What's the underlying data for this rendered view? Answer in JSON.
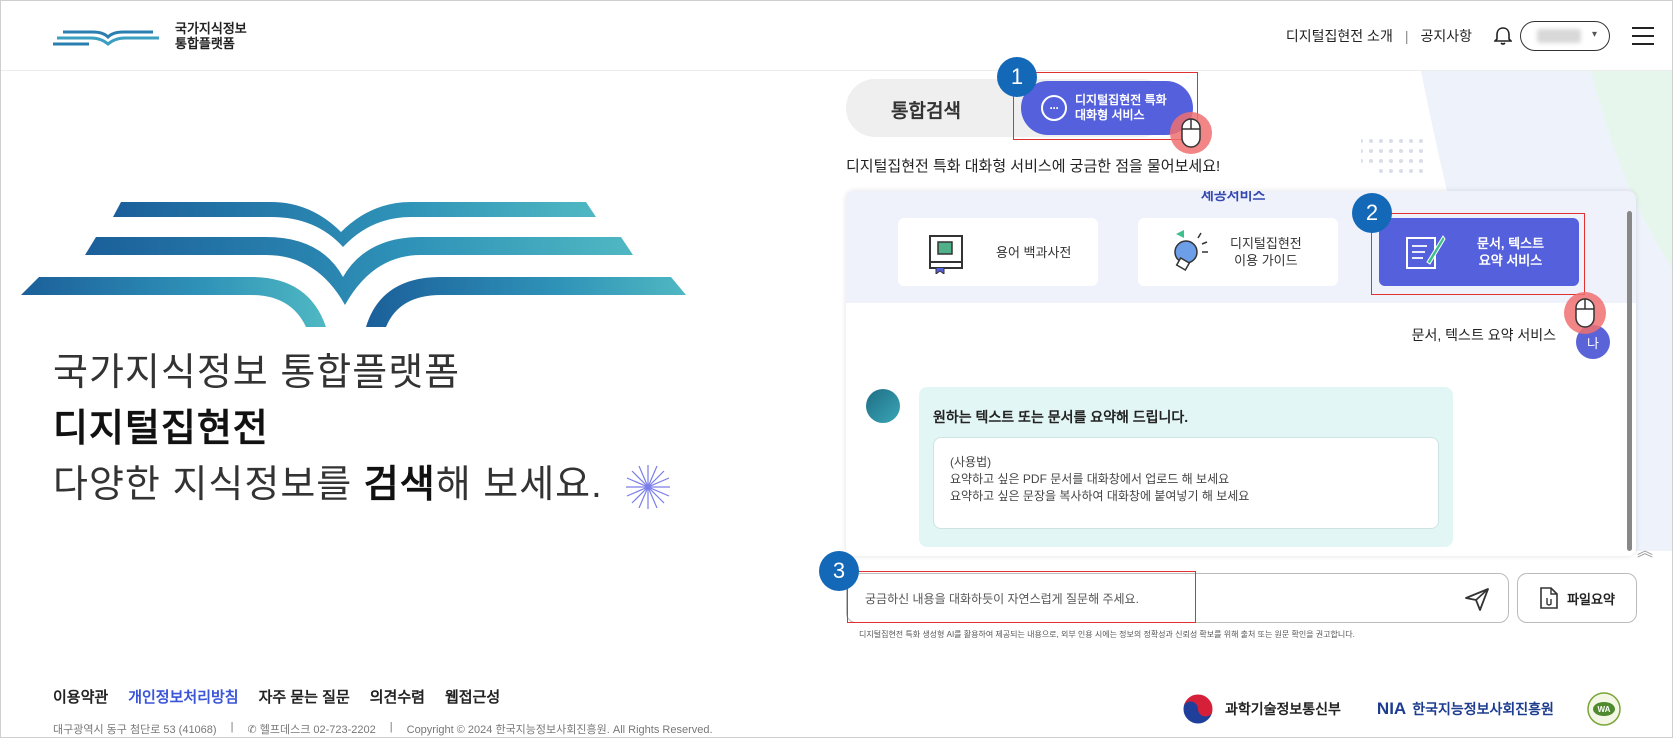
{
  "header": {
    "logo_line1": "국가지식정보",
    "logo_line2": "통합플랫폼",
    "nav_about": "디지털집현전 소개",
    "nav_sep": "|",
    "nav_notice": "공지사항"
  },
  "hero": {
    "line1": "국가지식정보 통합플랫폼",
    "line2": "디지털집현전",
    "line3_pre": "다양한 지식정보를 ",
    "line3_bold": "검색",
    "line3_post": "해 보세요."
  },
  "tabs": {
    "search": "통합검색",
    "chat_line1": "디지털집현전 특화",
    "chat_line2": "대화형 서비스"
  },
  "badges": [
    "1",
    "2",
    "3"
  ],
  "subtitle": "디지털집현전 특화 대화형 서비스에 궁금한 점을 물어보세요!",
  "services": {
    "title": "제공서비스",
    "items": [
      {
        "label": "용어 백과사전"
      },
      {
        "label_line1": "디지털집현전",
        "label_line2": "이용 가이드"
      },
      {
        "label_line1": "문서, 텍스트",
        "label_line2": "요약 서비스"
      }
    ]
  },
  "chat": {
    "user_message": "문서, 텍스트 요약 서비스",
    "user_avatar": "나",
    "bot_title": "원하는 텍스트 또는 문서를 요약해 드립니다.",
    "bot_usage_label": "(사용법)",
    "bot_usage_1": "요약하고 싶은 PDF 문서를 대화창에서 업로드 해 보세요",
    "bot_usage_2": "요약하고 싶은 문장을 복사하여 대화창에 붙여넣기 해 보세요"
  },
  "input": {
    "placeholder": "궁금하신 내용을 대화하듯이 자연스럽게 질문해 주세요.",
    "file_button": "파일요약",
    "disclaimer": "디지털집현전 특화 생성형 AI를 활용하여 제공되는 내용으로, 외부 인용 시에는 정보의 정확성과 신뢰성 확보를 위해 출처 또는 원문 확인을 권고합니다."
  },
  "footer": {
    "links": [
      "이용약관",
      "개인정보처리방침",
      "자주 묻는 질문",
      "의견수렴",
      "웹접근성"
    ],
    "address": "대구광역시 동구 첨단로 53 (41068)",
    "helpdesk": "헬프데스크 02-723-2202",
    "copyright": "Copyright © 2024 한국지능정보사회진흥원. All Rights Reserved.",
    "ministry": "과학기술정보통신부",
    "nia_abbr": "NIA",
    "nia_name": "한국지능정보사회진흥원"
  },
  "colors": {
    "accent": "#5560dd",
    "badge": "#1468b8",
    "highlight": "#e03030",
    "bubble": "#e3f6f6"
  }
}
